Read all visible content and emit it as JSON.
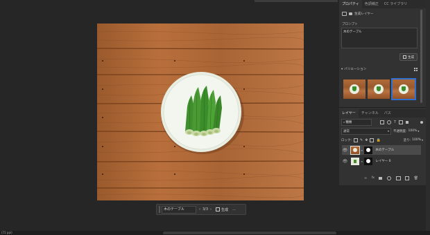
{
  "context_bar": {
    "prompt_value": "木のテーブル",
    "page_indicator": "3/3",
    "generate_label": "生成",
    "more_label": "..."
  },
  "properties_panel": {
    "tabs": [
      {
        "label": "プロパティ",
        "active": true
      },
      {
        "label": "色調補正",
        "active": false
      },
      {
        "label": "CC ライブラリ",
        "active": false
      }
    ],
    "layer_type": "生成レイヤー",
    "prompt_heading": "プロンプト",
    "prompt_value": "木のテーブル",
    "generate_label": "生成",
    "variations_heading": "バリエーション",
    "variations_count": 3,
    "selected_variation": 3
  },
  "layers_panel": {
    "tabs": [
      {
        "label": "レイヤー",
        "active": true
      },
      {
        "label": "チャンネル",
        "active": false
      },
      {
        "label": "パス",
        "active": false
      }
    ],
    "filter_kind": "種類",
    "blend_mode": "通常",
    "opacity_label": "不透明度:",
    "opacity_value": "100%",
    "lock_label": "ロック:",
    "fill_label": "塗り:",
    "fill_value": "100%",
    "layers": [
      {
        "name": "木のテーブル",
        "selected": true
      },
      {
        "name": "レイヤー 0",
        "selected": false
      }
    ]
  },
  "status_bar": {
    "zoom": "(72 ppi)"
  },
  "colors": {
    "app_bg": "#262626",
    "panel_bg": "#323232",
    "selection_accent": "#2f6fd0"
  }
}
